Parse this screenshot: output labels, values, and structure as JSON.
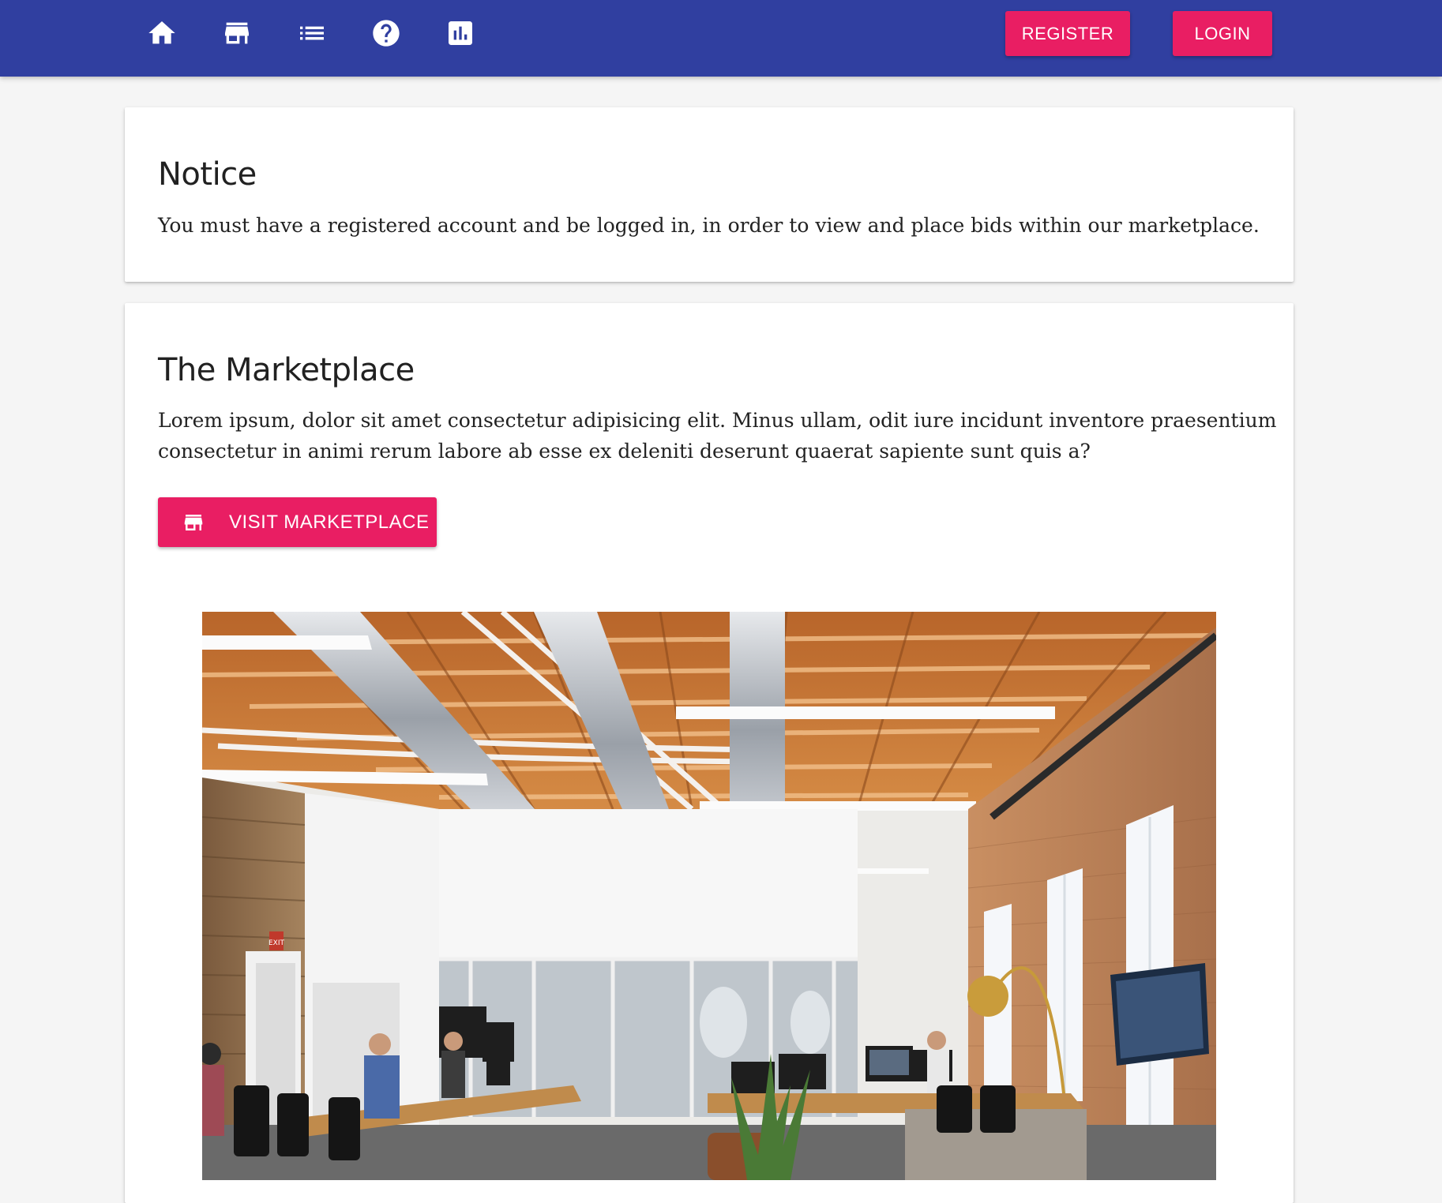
{
  "nav": {
    "icons": [
      "home-icon",
      "store-icon",
      "list-icon",
      "help-icon",
      "chart-icon"
    ],
    "register_label": "REGISTER",
    "login_label": "LOGIN"
  },
  "notice": {
    "title": "Notice",
    "text": "You must have a registered account and be logged in, in order to view and place bids within our marketplace."
  },
  "marketplace": {
    "title": "The Marketplace",
    "text": "Lorem ipsum, dolor sit amet consectetur adipisicing elit. Minus ullam, odit iure incidunt inventore praesentium consectetur in animi rerum labore ab esse ex deleniti deserunt quaerat sapiente sunt quis a?",
    "button_label": "VISIT MARKETPLACE",
    "button_icon": "store-icon",
    "image_label": "EXIT"
  },
  "colors": {
    "app_bar": "#303fa0",
    "accent": "#e91e63",
    "background": "#f5f5f5"
  }
}
